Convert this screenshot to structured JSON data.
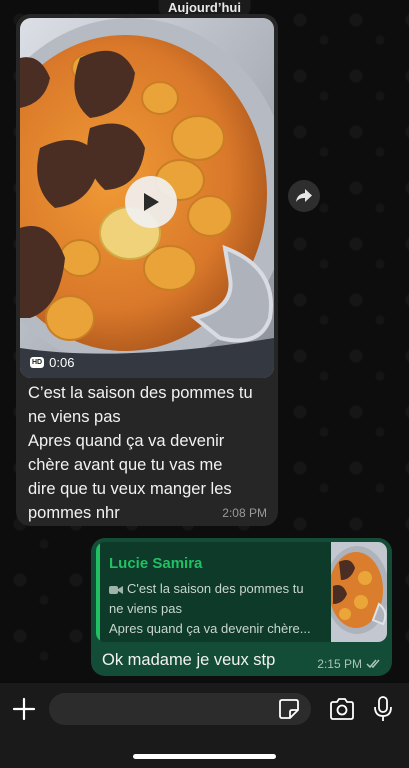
{
  "chat": {
    "date_separator": "Aujourd’hui"
  },
  "incoming": {
    "video_duration": "0:06",
    "video_quality_badge": "HD",
    "text": "C’est la saison des pommes tu\nne viens pas\nApres quand ça va devenir\nchère avant que tu vas me\ndire que tu veux manger les\npommes nhr",
    "time": "2:08 PM"
  },
  "outgoing": {
    "quote_author": "Lucie Samira",
    "quote_line1": "C'est la saison des pommes tu",
    "quote_line2": "ne viens pas",
    "quote_line3": "Apres quand ça va devenir chère...",
    "text": "Ok madame je veux stp",
    "time": "2:15 PM",
    "status": "read"
  },
  "colors": {
    "outgoing_bubble": "#134d37",
    "incoming_bubble": "#262626",
    "accent_green": "#21c063"
  },
  "icons": [
    "play-icon",
    "hd-icon",
    "forward-icon",
    "video-icon",
    "double-check-icon",
    "plus-icon",
    "sticker-icon",
    "camera-icon",
    "microphone-icon"
  ]
}
